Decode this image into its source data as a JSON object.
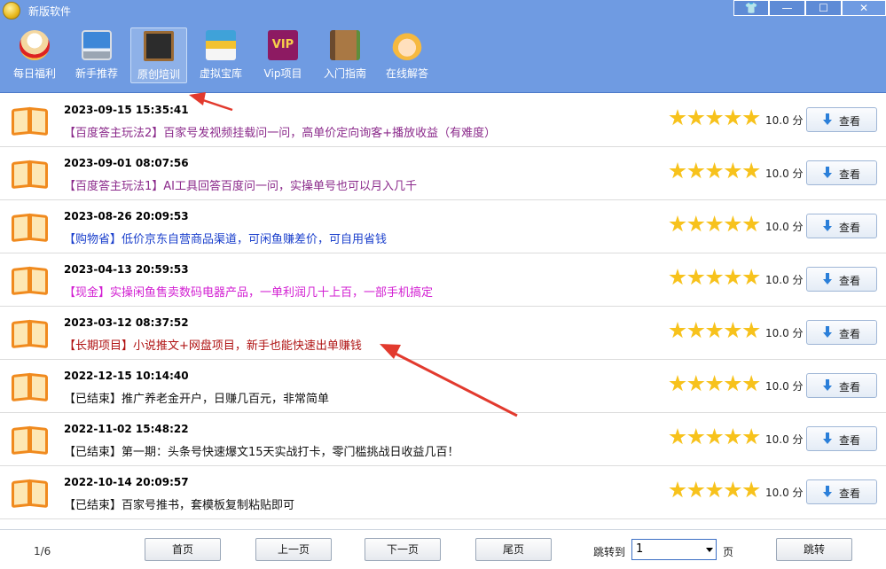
{
  "window": {
    "title": "新版软件",
    "controls": {
      "skin": "👕",
      "minimize": "—",
      "maximize": "☐",
      "close": "✕"
    }
  },
  "toolbar": {
    "items": [
      {
        "label": "每日福利",
        "icon": "lucky-cat-icon"
      },
      {
        "label": "新手推荐",
        "icon": "monitor-icon"
      },
      {
        "label": "原创培训",
        "icon": "blackboard-icon",
        "active": true
      },
      {
        "label": "虚拟宝库",
        "icon": "store-icon"
      },
      {
        "label": "Vip项目",
        "icon": "vip-icon",
        "badge": "VIP"
      },
      {
        "label": "入门指南",
        "icon": "guide-book-icon"
      },
      {
        "label": "在线解答",
        "icon": "support-agent-icon"
      }
    ]
  },
  "list": {
    "rows": [
      {
        "date": "2023-09-15 15:35:41",
        "title": "【百度答主玩法2】百家号发视频挂载问一问，高单价定向询客+播放收益（有难度）",
        "color": "#8b2a8b",
        "stars": 5,
        "score": "10.0 分",
        "view": "查看"
      },
      {
        "date": "2023-09-01 08:07:56",
        "title": "【百度答主玩法1】AI工具回答百度问一问，实操单号也可以月入几千",
        "color": "#8b2a8b",
        "stars": 5,
        "score": "10.0 分",
        "view": "查看"
      },
      {
        "date": "2023-08-26 20:09:53",
        "title": "【购物省】低价京东自营商品渠道，可闲鱼赚差价，可自用省钱",
        "color": "#1a3fcc",
        "stars": 5,
        "score": "10.0 分",
        "view": "查看"
      },
      {
        "date": "2023-04-13 20:59:53",
        "title": "【现金】实操闲鱼售卖数码电器产品，一单利润几十上百，一部手机搞定",
        "color": "#d21fd2",
        "stars": 5,
        "score": "10.0 分",
        "view": "查看"
      },
      {
        "date": "2023-03-12 08:37:52",
        "title": "【长期项目】小说推文+网盘项目，新手也能快速出单赚钱",
        "color": "#b01414",
        "stars": 5,
        "score": "10.0 分",
        "view": "查看"
      },
      {
        "date": "2022-12-15 10:14:40",
        "title": "【已结束】推广养老金开户，日赚几百元，非常简单",
        "color": "#111111",
        "stars": 5,
        "score": "10.0 分",
        "view": "查看"
      },
      {
        "date": "2022-11-02 15:48:22",
        "title": "【已结束】第一期：头条号快速爆文15天实战打卡，零门槛挑战日收益几百！",
        "color": "#111111",
        "stars": 5,
        "score": "10.0 分",
        "view": "查看"
      },
      {
        "date": "2022-10-14 20:09:57",
        "title": "【已结束】百家号推书，套模板复制粘贴即可",
        "color": "#111111",
        "stars": 5,
        "score": "10.0 分",
        "view": "查看"
      }
    ]
  },
  "pager": {
    "page_info": "1/6",
    "first": "首页",
    "prev": "上一页",
    "next": "下一页",
    "last": "尾页",
    "jump_label": "跳转到",
    "jump_value": "1",
    "page_unit": "页",
    "jump_button": "跳转"
  },
  "colors": {
    "chrome": "#6f9be2",
    "star": "#f7c21c",
    "annotation": "#e23a2e",
    "book": "#f08a1e"
  }
}
